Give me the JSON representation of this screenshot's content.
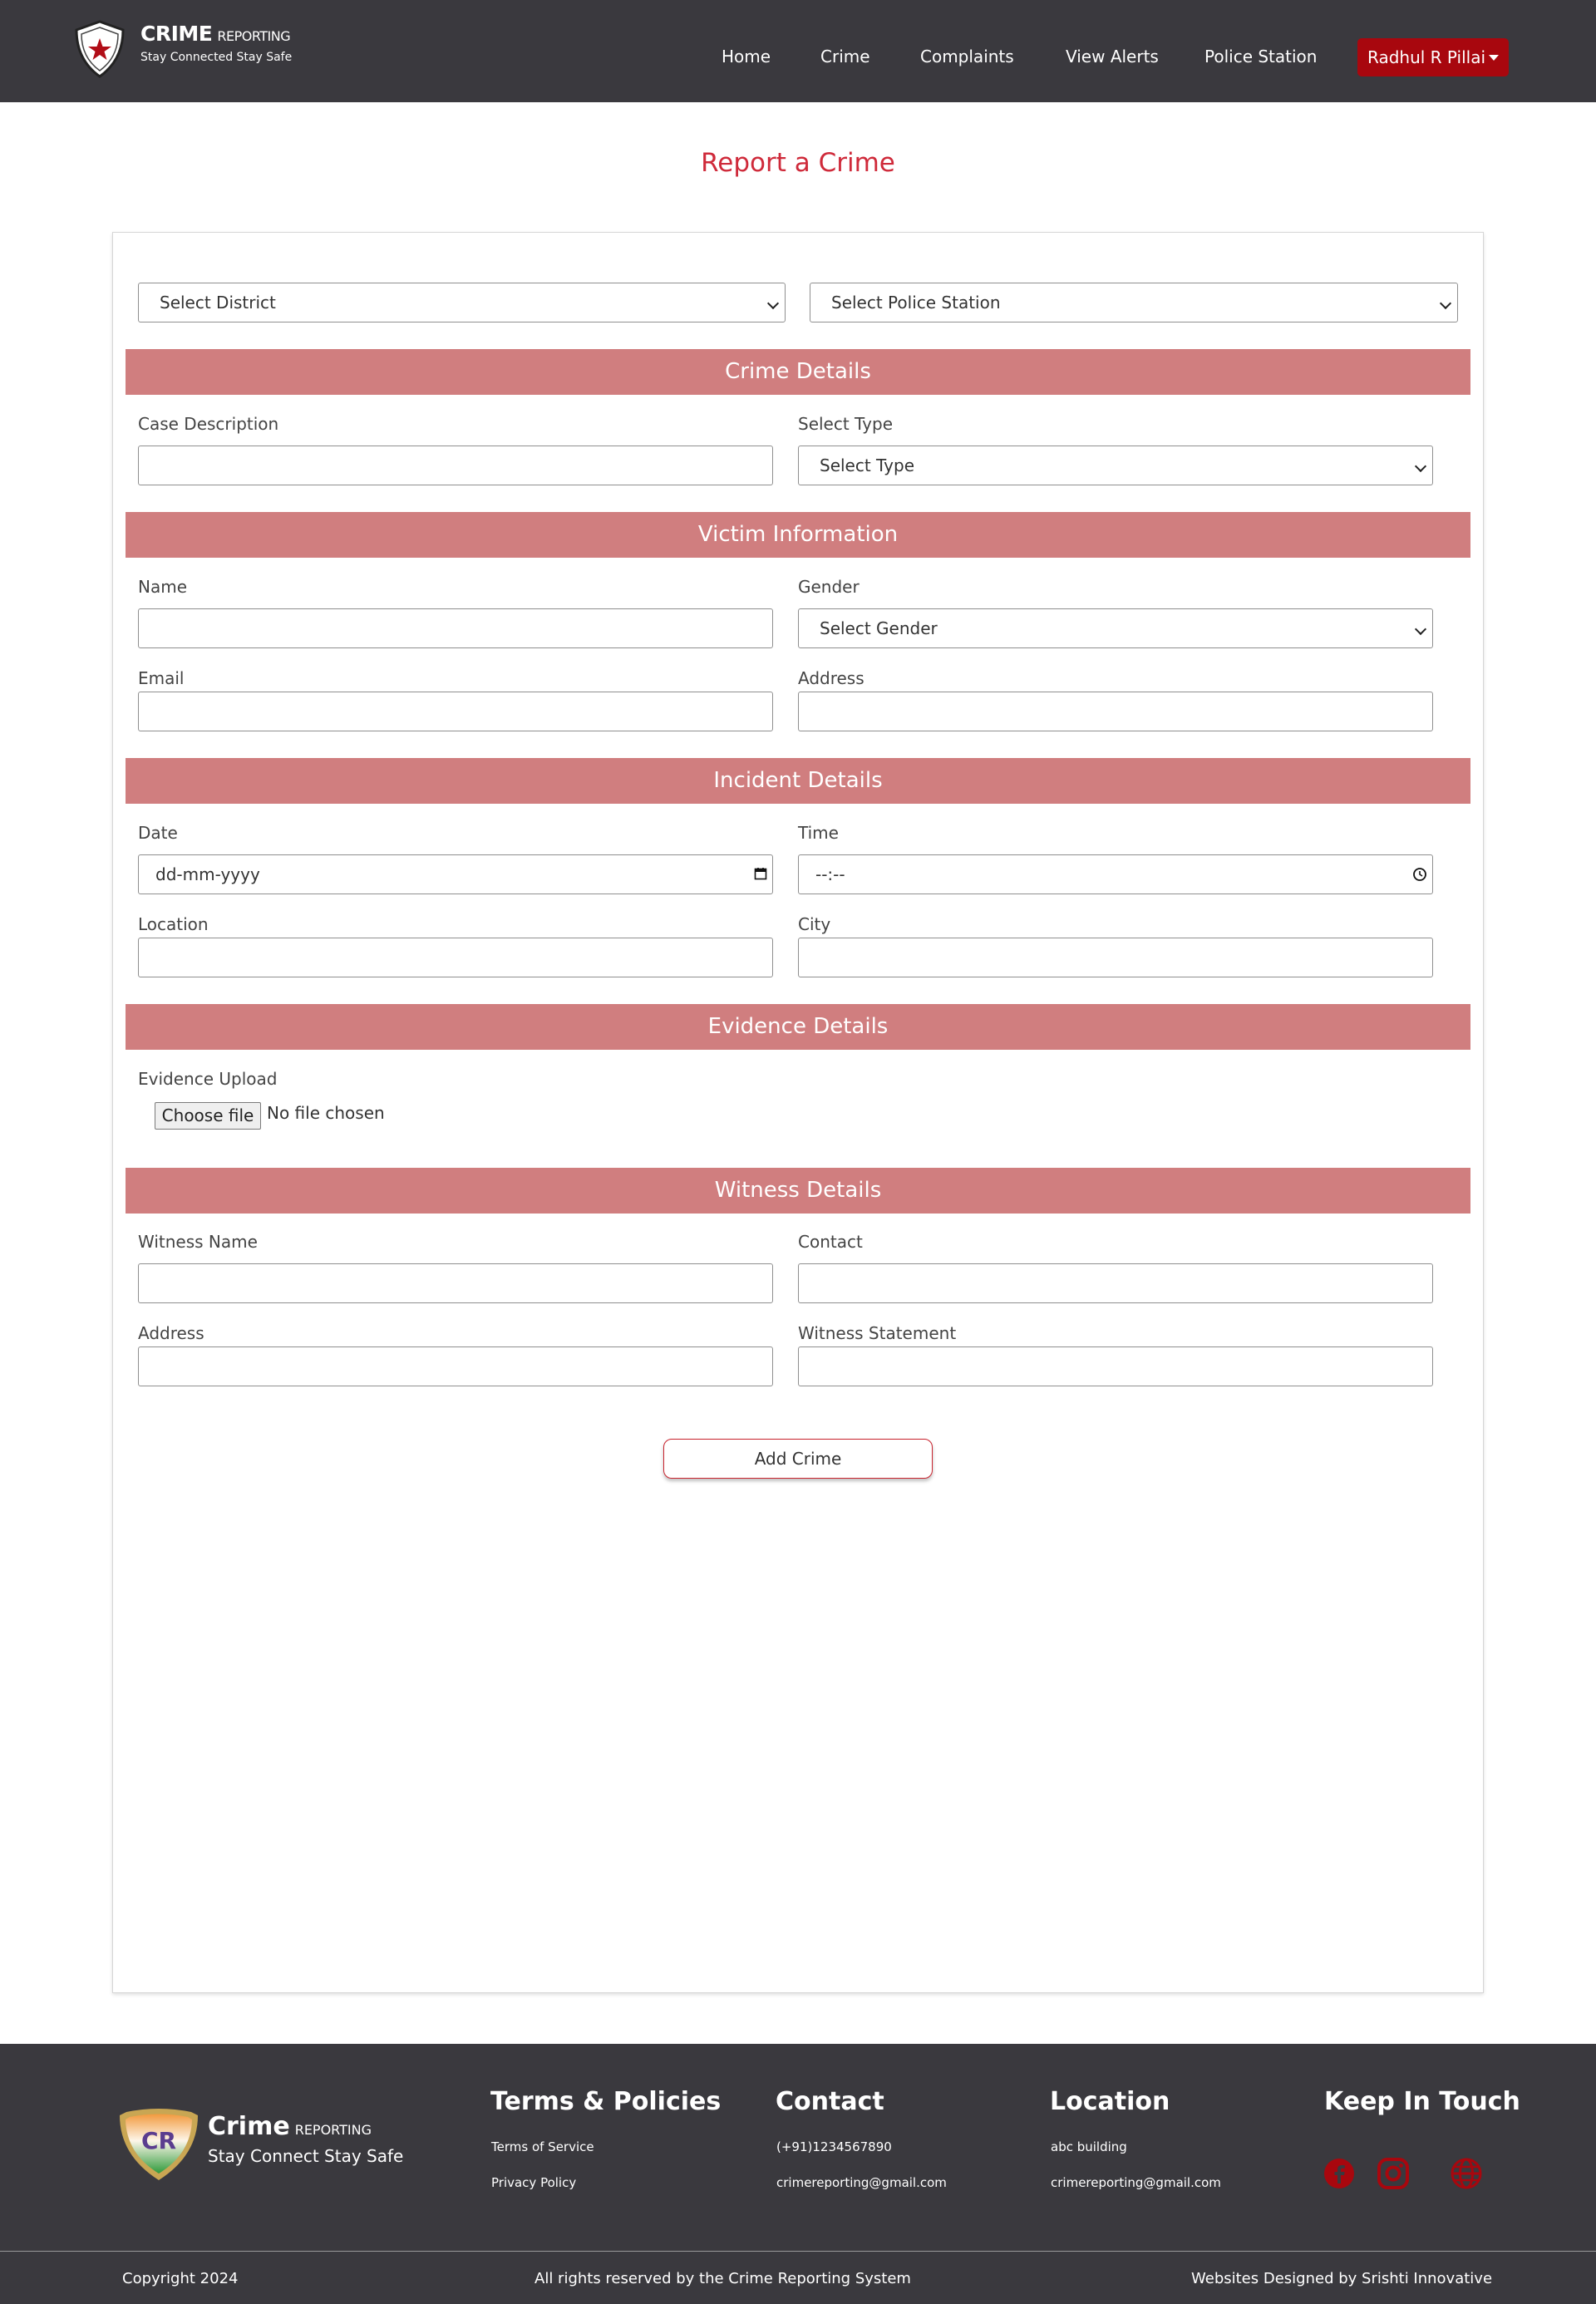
{
  "nav": {
    "brand_title": "CRIME",
    "brand_sub": "REPORTING",
    "brand_tagline": "Stay Connected Stay Safe",
    "links": [
      "Home",
      "Crime",
      "Complaints",
      "View Alerts",
      "Police Station"
    ],
    "user": "Radhul R Pillai"
  },
  "page_title": "Report a Crime",
  "form": {
    "district": "Select District",
    "police_station": "Select Police Station",
    "sections": {
      "crime": "Crime Details",
      "victim": "Victim Information",
      "incident": "Incident Details",
      "evidence": "Evidence Details",
      "witness": "Witness Details"
    },
    "labels": {
      "case_description": "Case Description",
      "select_type": "Select Type",
      "name": "Name",
      "gender": "Gender",
      "email": "Email",
      "address": "Address",
      "date": "Date",
      "time": "Time",
      "location": "Location",
      "city": "City",
      "evidence_upload": "Evidence Upload",
      "witness_name": "Witness Name",
      "contact": "Contact",
      "witness_address": "Address",
      "witness_statement": "Witness Statement"
    },
    "type_value": "Select Type",
    "gender_value": "Select Gender",
    "date_placeholder": "dd-mm-yyyy",
    "time_placeholder": "--:--",
    "file_button": "Choose file",
    "file_status": "No file chosen",
    "submit": "Add Crime"
  },
  "footer": {
    "brand_title": "Crime",
    "brand_sub": "REPORTING",
    "brand_tagline": "Stay Connect Stay Safe",
    "logo_text": "CR",
    "terms_head": "Terms & Policies",
    "terms_items": [
      "Terms of Service",
      "Privacy Policy"
    ],
    "contact_head": "Contact",
    "contact_items": [
      "(+91)1234567890",
      "crimereporting@gmail.com"
    ],
    "location_head": "Location",
    "location_items": [
      "abc building",
      "crimereporting@gmail.com"
    ],
    "keep_head": "Keep In Touch",
    "social_icons": [
      "facebook-icon",
      "instagram-icon",
      "globe-icon"
    ],
    "copyright": "Copyright 2024",
    "rights": "All rights reserved by the Crime Reporting System",
    "designed": "Websites Designed by Srishti Innovative"
  },
  "colors": {
    "navbar": "#3a393e",
    "accent": "#cf2a3a",
    "section": "#d07e7f",
    "user_button": "#a8070e"
  }
}
